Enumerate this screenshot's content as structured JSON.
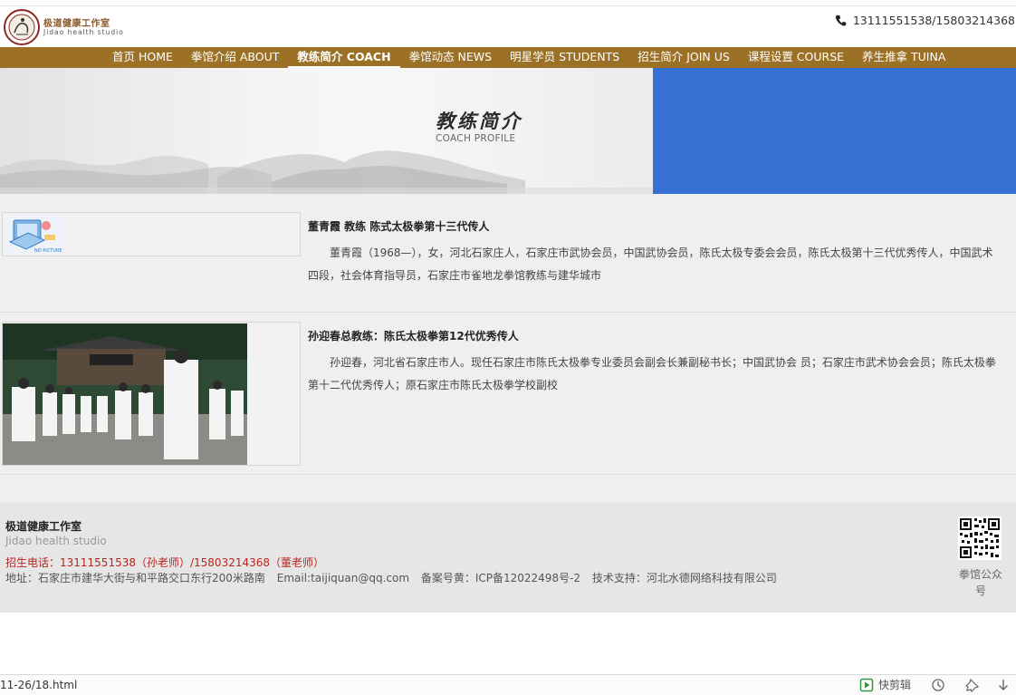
{
  "header": {
    "brand_cn": "极道健康工作室",
    "brand_en": "Jidao health studio",
    "phone": "13111551538/15803214368"
  },
  "nav": {
    "items": [
      {
        "label": "首页 HOME",
        "active": false
      },
      {
        "label": "拳馆介绍 ABOUT",
        "active": false
      },
      {
        "label": "教练简介 COACH",
        "active": true
      },
      {
        "label": "拳馆动态 NEWS",
        "active": false
      },
      {
        "label": "明星学员 STUDENTS",
        "active": false
      },
      {
        "label": "招生简介 JOIN US",
        "active": false
      },
      {
        "label": "课程设置 COURSE",
        "active": false
      },
      {
        "label": "养生推拿 TUINA",
        "active": false
      }
    ]
  },
  "banner": {
    "title": "教练简介",
    "subtitle": "COACH PROFILE"
  },
  "coaches": [
    {
      "name": "董青霞 教练 陈式太极拳第十三代传人",
      "desc": "董青霞（1968—），女，河北石家庄人，石家庄市武协会员，中国武协会员，陈氏太极专委会会员，陈氏太极第十三代优秀传人，中国武术四段，社会体育指导员，石家庄市雀地龙拳馆教练与建华城市",
      "image_label": "NO PICTURE"
    },
    {
      "name": "孙迎春总教练：陈氏太极拳第12代优秀传人",
      "desc": "孙迎春，河北省石家庄市人。现任石家庄市陈氏太极拳专业委员会副会长兼副秘书长；中国武协会 员；石家庄市武术协会会员；陈氏太极拳第十二代优秀传人；原石家庄市陈氏太极拳学校副校"
    }
  ],
  "footer": {
    "name": "极道健康工作室",
    "en": "Jidao health studio",
    "tel": "招生电话：13111551538（孙老师）/15803214368（董老师）",
    "address": "地址：石家庄市建华大街与和平路交口东行200米路南",
    "email": "Email:taijiquan@qq.com",
    "icp": "备案号黄：ICP备12022498号-2",
    "support": "技术支持：河北水德网络科技有限公司",
    "qr_label": "拳馆公众号"
  },
  "statusbar": {
    "url": "11-26/18.html",
    "clip_label": "快剪辑"
  },
  "colors": {
    "nav_bg": "#9c7126",
    "banner_blue": "#3570d2",
    "footer_tel": "#b8261e"
  }
}
